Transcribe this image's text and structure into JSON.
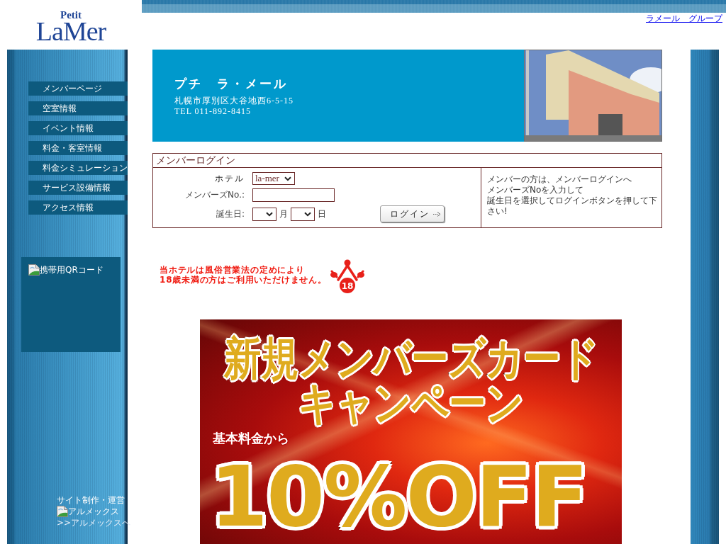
{
  "logo": {
    "small": "Petit",
    "large": "LaMer"
  },
  "top_link": "ラメール　グループ",
  "sidebar": {
    "items": [
      {
        "label": "メンバーページ"
      },
      {
        "label": "空室情報"
      },
      {
        "label": "イベント情報"
      },
      {
        "label": "料金・客室情報"
      },
      {
        "label": "料金シミュレーション"
      },
      {
        "label": "サービス設備情報"
      },
      {
        "label": "アクセス情報"
      }
    ],
    "qr_image_alt": "携帯用QRコード",
    "credits": {
      "title": "サイト制作・運営",
      "image_alt": "アルメックス",
      "link": ">>アルメックスへ"
    }
  },
  "hotel": {
    "name": "プチ　ラ・メール",
    "address": "札幌市厚別区大谷地西6-5-15",
    "tel": "TEL 011-892-8415"
  },
  "login": {
    "title": "メンバーログイン",
    "hotel": {
      "label": "ホテル",
      "value": "la-mer"
    },
    "member_no": {
      "label": "メンバーズNo.:"
    },
    "birthday": {
      "label": "誕生日:",
      "month_unit": "月",
      "day_unit": "日"
    },
    "button": "ログイン",
    "note": [
      "メンバーの方は、メンバーログインへ",
      "メンバーズNoを入力して",
      "誕生日を選択してログインボタンを押して下さい!"
    ]
  },
  "notice": {
    "lines": [
      "当ホテルは風俗営業法の定めにより",
      "18歳未満の方はご利用いただけません。"
    ],
    "badge": "18"
  },
  "banner": {
    "headline": "新規メンバーズカード",
    "subheadline": "キャンペーン",
    "label": "基本料金から",
    "discount": "10%OFF"
  }
}
